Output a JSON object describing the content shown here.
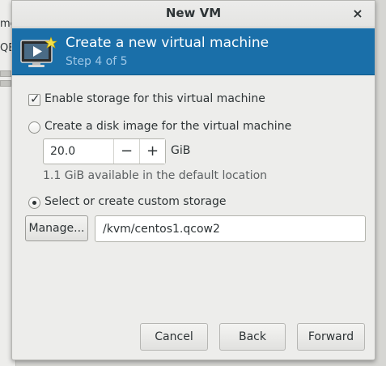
{
  "background_window": {
    "line1": "me",
    "line2": "QEN"
  },
  "dialog": {
    "title": "New VM",
    "close_label": "×"
  },
  "header": {
    "title": "Create a new virtual machine",
    "step": "Step 4 of 5",
    "icon": "vm-monitor-star-icon",
    "bg_color": "#1a6fa9"
  },
  "storage": {
    "enable_label": "Enable storage for this virtual machine",
    "enable_checked": true,
    "create_disk_label": "Create a disk image for the virtual machine",
    "disk_size": "20.0",
    "minus_label": "−",
    "plus_label": "+",
    "unit": "GiB",
    "available_text": "1.1 GiB available in the default location",
    "custom_label": "Select or create custom storage",
    "selected_option": "custom",
    "manage_label": "Manage...",
    "path": "/kvm/centos1.qcow2"
  },
  "buttons": {
    "cancel": "Cancel",
    "back": "Back",
    "forward": "Forward"
  }
}
